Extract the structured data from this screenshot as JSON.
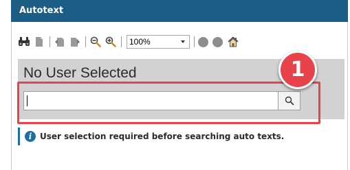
{
  "window": {
    "title": "Autotext"
  },
  "toolbar": {
    "buttons": [
      {
        "name": "find-icon"
      },
      {
        "name": "page-icon"
      },
      {
        "name": "back-icon"
      },
      {
        "name": "forward-icon"
      },
      {
        "name": "zoom-out-icon"
      },
      {
        "name": "zoom-in-icon"
      }
    ],
    "zoom_value": "100%",
    "extra_buttons": [
      "circle-icon",
      "circle-icon",
      "home-icon"
    ]
  },
  "main": {
    "user_heading": "No User Selected",
    "search": {
      "value": "",
      "placeholder": ""
    },
    "callout_number": "1",
    "info_message": "User selection required before searching auto texts."
  },
  "colors": {
    "titlebar": "#1c5d85",
    "callout": "#e8434a",
    "info_accent": "#1c6ea4",
    "panel_gray": "#d2d2d2"
  }
}
